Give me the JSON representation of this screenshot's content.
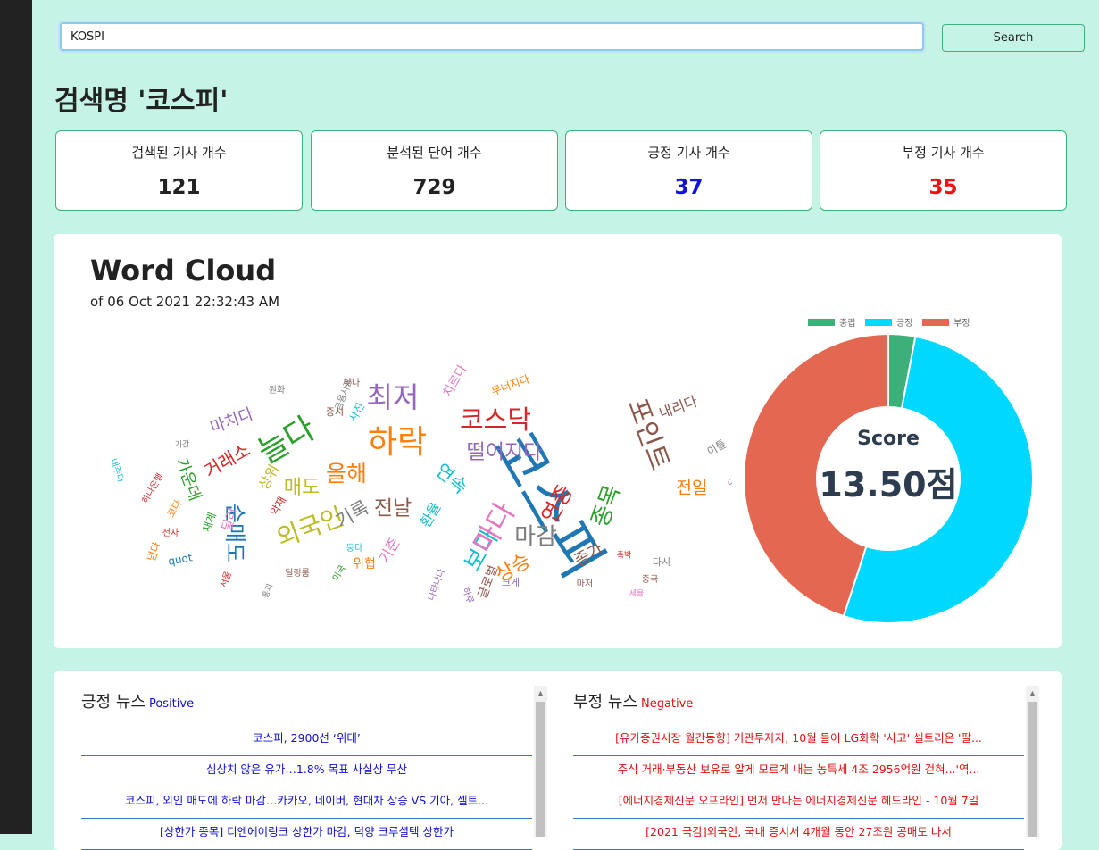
{
  "search": {
    "value": "KOSPI",
    "button_label": "Search"
  },
  "page_title": "검색명 '코스피'",
  "stats": [
    {
      "label": "검색된 기사 개수",
      "value": "121",
      "color": "#222222"
    },
    {
      "label": "분석된 단어 개수",
      "value": "729",
      "color": "#222222"
    },
    {
      "label": "긍정 기사 개수",
      "value": "37",
      "color": "#1010e0"
    },
    {
      "label": "부정 기사 개수",
      "value": "35",
      "color": "#ee1111"
    }
  ],
  "word_cloud": {
    "title": "Word Cloud",
    "subtitle": "of 06 Oct 2021 22:32:43 AM",
    "words": [
      {
        "text": "코스피",
        "size": 64,
        "color": "#1f77b4",
        "rot": 60
      },
      {
        "text": "최저",
        "size": 32,
        "color": "#9467bd",
        "rot": 0
      },
      {
        "text": "하락",
        "size": 36,
        "color": "#ff7f0e",
        "rot": 0
      },
      {
        "text": "코스닥",
        "size": 29,
        "color": "#d62728",
        "rot": 0
      },
      {
        "text": "늘다",
        "size": 36,
        "color": "#2ca02c",
        "rot": -30
      },
      {
        "text": "포인트",
        "size": 30,
        "color": "#8c564b",
        "rot": 70
      },
      {
        "text": "떨어지다",
        "size": 23,
        "color": "#9467bd",
        "rot": 0
      },
      {
        "text": "올해",
        "size": 25,
        "color": "#ff7f0e",
        "rot": 0
      },
      {
        "text": "외국인",
        "size": 28,
        "color": "#bcbd22",
        "rot": -20
      },
      {
        "text": "매도",
        "size": 22,
        "color": "#bcbd22",
        "rot": 0
      },
      {
        "text": "기록",
        "size": 21,
        "color": "#7f7f7f",
        "rot": -30
      },
      {
        "text": "전날",
        "size": 23,
        "color": "#8c564b",
        "rot": 0
      },
      {
        "text": "연속",
        "size": 21,
        "color": "#17becf",
        "rot": 40
      },
      {
        "text": "마감",
        "size": 26,
        "color": "#7f7f7f",
        "rot": 0
      },
      {
        "text": "종목",
        "size": 26,
        "color": "#2ca02c",
        "rot": -70
      },
      {
        "text": "연중",
        "size": 24,
        "color": "#d62728",
        "rot": -60
      },
      {
        "text": "보다",
        "size": 26,
        "color": "#17becf",
        "rot": -60
      },
      {
        "text": "마다",
        "size": 32,
        "color": "#e377c2",
        "rot": -60
      },
      {
        "text": "상승",
        "size": 22,
        "color": "#ff7f0e",
        "rot": -30
      },
      {
        "text": "순매도",
        "size": 24,
        "color": "#1f77b4",
        "rot": 90
      },
      {
        "text": "거래소",
        "size": 20,
        "color": "#d62728",
        "rot": -30
      },
      {
        "text": "가운데",
        "size": 18,
        "color": "#2ca02c",
        "rot": 70
      },
      {
        "text": "마치다",
        "size": 18,
        "color": "#9467bd",
        "rot": -20
      },
      {
        "text": "내리다",
        "size": 16,
        "color": "#8c564b",
        "rot": -20
      },
      {
        "text": "전일",
        "size": 19,
        "color": "#ff7f0e",
        "rot": 0
      },
      {
        "text": "종가",
        "size": 18,
        "color": "#8c564b",
        "rot": -30
      },
      {
        "text": "치르다",
        "size": 14,
        "color": "#e377c2",
        "rot": -60
      },
      {
        "text": "무너지다",
        "size": 12,
        "color": "#ff7f0e",
        "rot": -20
      },
      {
        "text": "quot",
        "size": 12,
        "color": "#1f77b4",
        "rot": -10
      },
      {
        "text": "낮다",
        "size": 10,
        "color": "#8c564b",
        "rot": 0
      },
      {
        "text": "금융시장",
        "size": 10,
        "color": "#7f7f7f",
        "rot": -70
      },
      {
        "text": "환율",
        "size": 16,
        "color": "#17becf",
        "rot": -60
      },
      {
        "text": "기준",
        "size": 16,
        "color": "#e377c2",
        "rot": -60
      },
      {
        "text": "위협",
        "size": 14,
        "color": "#ff7f0e",
        "rot": 0
      },
      {
        "text": "글로벌",
        "size": 14,
        "color": "#8c564b",
        "rot": -70
      },
      {
        "text": "크게",
        "size": 11,
        "color": "#9467bd",
        "rot": 0
      },
      {
        "text": "다시",
        "size": 11,
        "color": "#7f7f7f",
        "rot": 0
      },
      {
        "text": "마저",
        "size": 10,
        "color": "#8c564b",
        "rot": 0
      },
      {
        "text": "이틀",
        "size": 12,
        "color": "#7f7f7f",
        "rot": -30
      },
      {
        "text": "오르다",
        "size": 11,
        "color": "#9467bd",
        "rot": -60
      },
      {
        "text": "증시",
        "size": 11,
        "color": "#8c564b",
        "rot": 0
      },
      {
        "text": "사진",
        "size": 12,
        "color": "#17becf",
        "rot": -60
      },
      {
        "text": "원화",
        "size": 10,
        "color": "#7f7f7f",
        "rot": 0
      },
      {
        "text": "기간",
        "size": 9,
        "color": "#7f7f7f",
        "rot": 0
      },
      {
        "text": "하나은행",
        "size": 10,
        "color": "#d62728",
        "rot": -60
      },
      {
        "text": "내주다",
        "size": 10,
        "color": "#17becf",
        "rot": 70
      },
      {
        "text": "넘다",
        "size": 12,
        "color": "#ff7f0e",
        "rot": -70
      },
      {
        "text": "전자",
        "size": 10,
        "color": "#d62728",
        "rot": 0
      },
      {
        "text": "재계",
        "size": 12,
        "color": "#2ca02c",
        "rot": -70
      },
      {
        "text": "달러",
        "size": 14,
        "color": "#e377c2",
        "rot": -70
      },
      {
        "text": "상위",
        "size": 16,
        "color": "#bcbd22",
        "rot": -60
      },
      {
        "text": "악재",
        "size": 12,
        "color": "#d62728",
        "rot": -60
      },
      {
        "text": "딜링룸",
        "size": 10,
        "color": "#8c564b",
        "rot": 0
      },
      {
        "text": "미국",
        "size": 10,
        "color": "#2ca02c",
        "rot": -60
      },
      {
        "text": "중국",
        "size": 10,
        "color": "#8c564b",
        "rot": 0
      },
      {
        "text": "세율",
        "size": 9,
        "color": "#e377c2",
        "rot": 0
      },
      {
        "text": "축박",
        "size": 9,
        "color": "#d62728",
        "rot": 0
      },
      {
        "text": "하루",
        "size": 10,
        "color": "#9467bd",
        "rot": 70
      },
      {
        "text": "나타나다",
        "size": 10,
        "color": "#9467bd",
        "rot": -70
      },
      {
        "text": "코다",
        "size": 11,
        "color": "#ff7f0e",
        "rot": -60
      },
      {
        "text": "서울",
        "size": 10,
        "color": "#d62728",
        "rot": -70
      },
      {
        "text": "등다",
        "size": 10,
        "color": "#17becf",
        "rot": 0
      },
      {
        "text": "통괴",
        "size": 9,
        "color": "#7f7f7f",
        "rot": -70
      }
    ]
  },
  "donut": {
    "legend": [
      "중립",
      "긍정",
      "부정"
    ],
    "colors": [
      "#3daf78",
      "#00d8ff",
      "#e46751"
    ],
    "values": [
      3,
      52,
      45
    ],
    "score_label": "Score",
    "score_value": "13.50점"
  },
  "positive_news": {
    "title": "긍정 뉴스",
    "subtitle": "Positive",
    "color": "#1010d0",
    "items": [
      "코스피, 2900선 ‘위태’",
      "심상치 않은 유가…1.8% 목표 사실상 무산",
      "코스피, 외인 매도에 하락 마감…카카오, 네이버, 현대차 상승 VS 기아, 셀트...",
      "[상한가 종목] 디엔에이링크 상한가 마감, 덕양 크루셜텍 상한가"
    ]
  },
  "negative_news": {
    "title": "부정 뉴스",
    "subtitle": "Negative",
    "color": "#e01010",
    "items": [
      "[유가증권시장 월간동향] 기관투자자, 10월 들어 LG화학 '사고' 셀트리온 '팔...",
      "주식 거래·부동산 보유로 알게 모르게 내는 농특세 4조 2956억원 걷혀...'역...",
      "[에너지경제신문 오프라인] 먼저 만나는 에너지경제신문 헤드라인 - 10월 7일",
      "[2021 국감]외국인, 국내 증시서 4개월 동안 27조원 공매도 나서"
    ]
  }
}
